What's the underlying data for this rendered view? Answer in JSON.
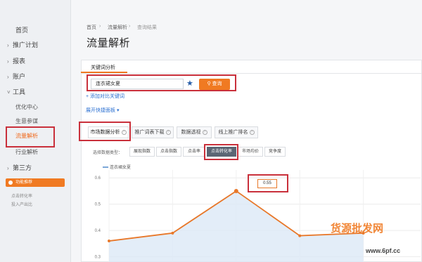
{
  "sidebar": {
    "items": [
      {
        "label": "首页"
      },
      {
        "label": "推广计划"
      },
      {
        "label": "报表"
      },
      {
        "label": "账户"
      },
      {
        "label": "工具"
      }
    ],
    "tools_sub": [
      {
        "label": "优化中心"
      },
      {
        "label": "生意参谋"
      },
      {
        "label": "流量解析"
      },
      {
        "label": "行业解析"
      }
    ],
    "third_party": {
      "label": "第三方"
    },
    "promo": {
      "label": "功能推荐",
      "lines": [
        "点击转化率",
        "投入产出比"
      ]
    }
  },
  "breadcrumb": [
    "首页",
    "流量解析",
    "查询结果"
  ],
  "page_title": "流量解析",
  "keyword_tab": "关键词分析",
  "search": {
    "value": "连衣裙女夏",
    "button": "查询"
  },
  "links": {
    "add_compare": "添加对比关键词",
    "expand": "展开快捷面板"
  },
  "subtabs": [
    "市场数据分析",
    "推广词表下载",
    "数据透视",
    "线上推广排名"
  ],
  "data_types": {
    "label": "选择数据类型：",
    "options": [
      "展现指数",
      "点击指数",
      "点击率",
      "点击转化率",
      "市场均价",
      "竞争度"
    ],
    "selected": "点击转化率"
  },
  "chart_data": {
    "type": "line",
    "series": [
      {
        "name": "连衣裙女夏",
        "values": [
          0.36,
          0.39,
          0.55,
          0.38,
          0.39
        ]
      }
    ],
    "x": [
      0,
      1,
      2,
      3,
      4
    ],
    "yticks": [
      "0.6",
      "0.5",
      "0.4",
      "0.3"
    ],
    "ylim": [
      0.28,
      0.63
    ],
    "annotation": "0.55",
    "color": "#e8782a"
  },
  "watermark": {
    "top": "货源批发网",
    "bottom": "www.6pf.cc"
  }
}
